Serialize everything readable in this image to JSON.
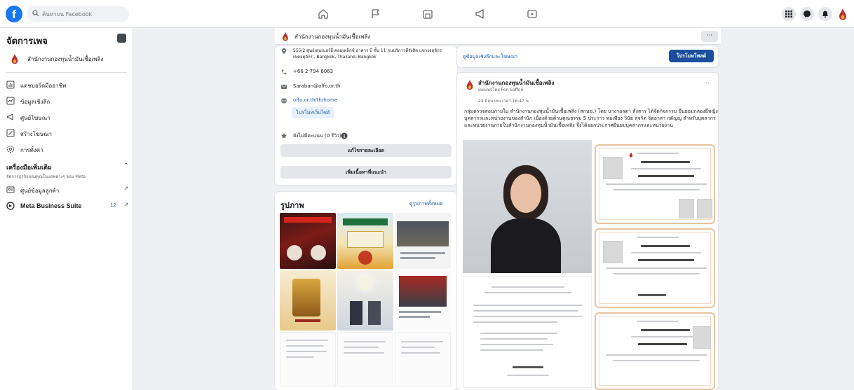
{
  "topbar": {
    "search_placeholder": "ค้นหาบน Facebook",
    "nav_icons": [
      "home-icon",
      "flag-icon",
      "marketplace-icon",
      "megaphone-icon",
      "video-icon"
    ],
    "right_icons": [
      "grid-icon",
      "messenger-icon",
      "bell-icon"
    ]
  },
  "sidebar": {
    "title": "จัดการเพจ",
    "page_name": "สำนักงานกองทุนน้ำมันเชื้อเพลิง",
    "items": [
      {
        "label": "แดชบอร์ดมืออาชีพ",
        "icon": "dashboard-icon"
      },
      {
        "label": "ข้อมูลเชิงลึก",
        "icon": "insights-icon"
      },
      {
        "label": "ศูนย์โฆษณา",
        "icon": "ad-center-icon"
      },
      {
        "label": "สร้างโฆษณา",
        "icon": "create-ad-icon"
      },
      {
        "label": "การตั้งค่า",
        "icon": "settings-icon"
      }
    ],
    "tools_title": "เครื่องมือเพิ่มเติม",
    "tools_subtitle": "จัดการธุรกิจของคุณในแอพต่างๆ ของ Meta",
    "tools": [
      {
        "label": "ศูนย์ข้อมูลลูกค้า",
        "icon": "customer-info-icon"
      },
      {
        "label": "Meta Business Suite",
        "icon": "meta-suite-icon",
        "badge": "12"
      }
    ]
  },
  "pagebar": {
    "page_name": "สำนักงานกองทุนน้ำมันเชื้อเพลิง",
    "more_label": "···"
  },
  "intro": {
    "address": "555/2 ศูนย์เอนเนอร์ยี่ คอมเพล็กซ์ อาคาร บี ชั้น 11 ถนนวิภาวดีรังสิต แขวงจตุจักร เขตจตุจักร , Bangkok, Thailand, Bangkok",
    "phone": "+66 2 794 6063",
    "email": "Saraban@offo.or.th",
    "website": "offo.or.th/th/home",
    "promote_site_label": "โปรโมทเว็บไซต์",
    "rating": "ยังไม่มีคะแนน (0 รีวิว)",
    "edit_details_label": "แก้ไขรายละเอียด",
    "add_featured_label": "เพิ่มเนื้อหาที่แนะนำ"
  },
  "photos": {
    "title": "รูปภาพ",
    "see_all_label": "ดูรูปภาพทั้งหมด"
  },
  "promo_card": {
    "link_label": "ดูข้อมูลเชิงลึกและโฆษณา",
    "button_label": "โปรโมทโพสต์"
  },
  "post": {
    "page_name": "สำนักงานกองทุนน้ำมันเชื้อเพลิง",
    "posted_by": "เผยแพร่โดย Fon Saffon",
    "time": "24 มิถุนายน เวลา 16:47 น. · ",
    "text": "กลุ่มตรวจสอบภายใน สำนักงานกองทุนน้ำมันเชื้อเพลิง (สกนช.) โดย นางรอลดา สังสาร ได้จัดกิจกรรม ยืนยอมกลองยี่หญิงบุคลากรและหน่วยงานของสำนัก เนื่องด้วยด้านคุณธรรม 5 ประการ พอเพียง วินัย สุจริต จิตอาสา กตัญญู สำหรับบุคลากรและหน่วยงานภายในสำนักงานกองทุนน้ำมันเชื้อเพลิง จึงได้ออกประกาศยืนยมบุคลากรและหน่วยงาน",
    "menu_label": "···"
  },
  "colors": {
    "fb_blue": "#1877f2",
    "primary_button": "#1b4f9c",
    "link": "#1a5fb4",
    "cert_border": "#e7c3a0"
  }
}
